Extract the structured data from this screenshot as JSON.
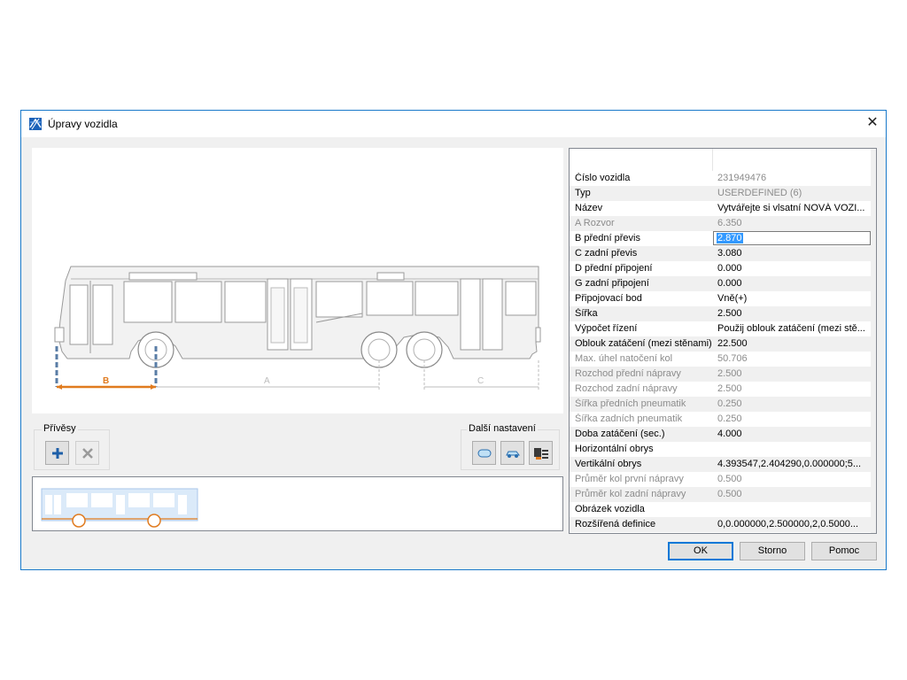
{
  "window": {
    "title": "Úpravy vozidla",
    "close_symbol": "✕"
  },
  "trailers_group": {
    "label": "Přívěsy",
    "add_icon": "plus-icon",
    "remove_icon": "x-icon"
  },
  "more_settings_group": {
    "label": "Další nastavení",
    "icons": [
      "vehicle-outline-icon",
      "car-icon",
      "vehicle-settings-icon"
    ]
  },
  "drawing": {
    "dim_b_label": "B",
    "dim_a_label": "A",
    "dim_c_label": "C",
    "dim_accent_color": "#e07b1f"
  },
  "properties": [
    {
      "name": "Číslo vozidla",
      "value": "231949476",
      "disabled_value": true
    },
    {
      "name": "Typ",
      "value": "USERDEFINED (6)",
      "disabled_value": true
    },
    {
      "name": "Název",
      "value": "Vytvářejte si vlsatní NOVÁ VOZI..."
    },
    {
      "name": "A Rozvor",
      "value": "6.350",
      "disabled": true
    },
    {
      "name": "B přední převis",
      "value": "2.870",
      "editing": true
    },
    {
      "name": "C zadní převis",
      "value": "3.080"
    },
    {
      "name": "D přední připojení",
      "value": "0.000"
    },
    {
      "name": "G zadní připojení",
      "value": "0.000"
    },
    {
      "name": "Připojovací bod",
      "value": "Vně(+)"
    },
    {
      "name": "Šířka",
      "value": "2.500"
    },
    {
      "name": "Výpočet řízení",
      "value": "Použij oblouk zatáčení (mezi stě..."
    },
    {
      "name": "Oblouk zatáčení (mezi stěnami)",
      "value": "22.500"
    },
    {
      "name": "Max. úhel natočení kol",
      "value": "50.706",
      "disabled": true
    },
    {
      "name": "Rozchod přední nápravy",
      "value": "2.500",
      "disabled": true
    },
    {
      "name": "Rozchod zadní nápravy",
      "value": "2.500",
      "disabled": true
    },
    {
      "name": "Šířka předních pneumatik",
      "value": "0.250",
      "disabled": true
    },
    {
      "name": "Šířka zadních pneumatik",
      "value": "0.250",
      "disabled": true
    },
    {
      "name": "Doba zatáčení (sec.)",
      "value": "4.000"
    },
    {
      "name": "Horizontální obrys",
      "value": ""
    },
    {
      "name": "Vertikální obrys",
      "value": "4.393547,2.404290,0.000000;5..."
    },
    {
      "name": "Průměr kol první nápravy",
      "value": "0.500",
      "disabled": true
    },
    {
      "name": "Průměr kol zadní nápravy",
      "value": "0.500",
      "disabled": true
    },
    {
      "name": "Obrázek vozidla",
      "value": ""
    },
    {
      "name": "Rozšířená definice",
      "value": "0,0.000000,2.500000,2,0.5000..."
    }
  ],
  "buttons": {
    "ok": "OK",
    "cancel": "Storno",
    "help": "Pomoc"
  }
}
